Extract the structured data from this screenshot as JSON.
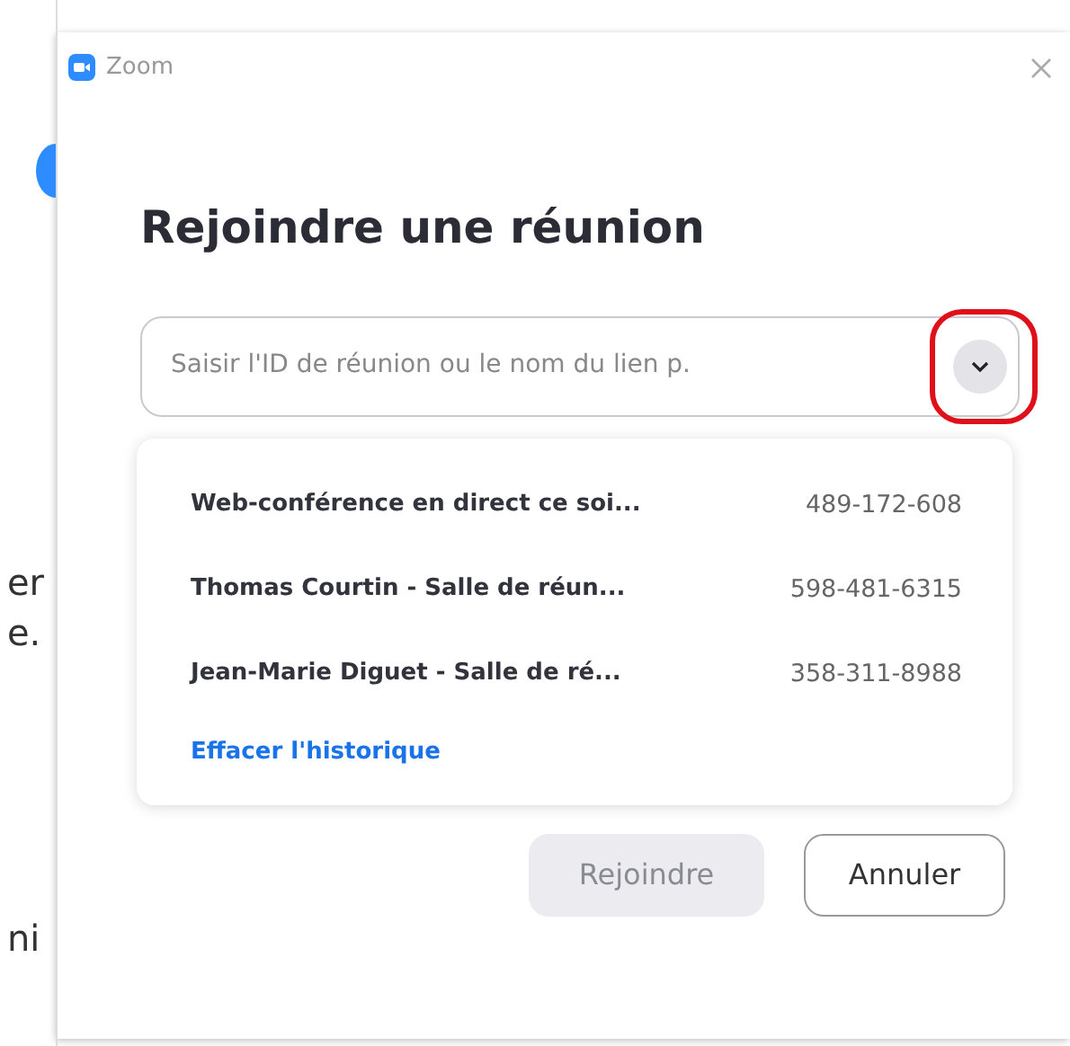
{
  "background": {
    "fragments": [
      "er",
      "e.",
      "ni"
    ]
  },
  "window": {
    "title": "Zoom"
  },
  "heading": "Rejoindre une réunion",
  "meeting_field": {
    "placeholder": "Saisir l'ID de réunion ou le nom du lien p.",
    "expanded": true,
    "highlighted": true
  },
  "history": [
    {
      "name": "Web-conférence en direct ce soi...",
      "id": "489-172-608"
    },
    {
      "name": "Thomas Courtin - Salle de réun...",
      "id": "598-481-6315"
    },
    {
      "name": "Jean-Marie Diguet - Salle de ré...",
      "id": "358-311-8988"
    }
  ],
  "clear_history": "Effacer l'historique",
  "buttons": [
    {
      "label": "Rejoindre",
      "disabled": true
    },
    {
      "label": "Annuler",
      "disabled": false
    }
  ]
}
